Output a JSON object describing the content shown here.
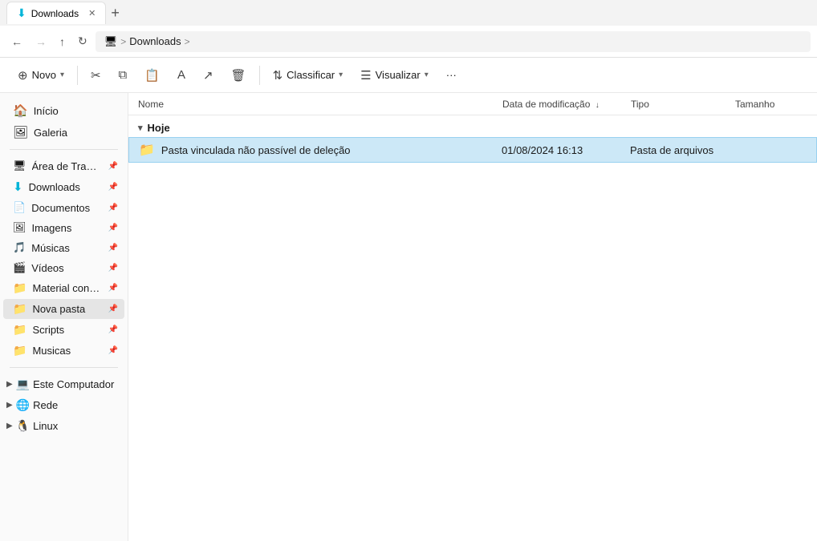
{
  "titlebar": {
    "tab_label": "Downloads",
    "new_tab_icon": "+",
    "tab_close": "✕"
  },
  "addressbar": {
    "nav_back": "←",
    "nav_forward": "→",
    "nav_up": "↑",
    "nav_refresh": "↻",
    "monitor_icon": "🖥",
    "breadcrumb_sep": ">",
    "path_item": "Downloads",
    "path_arrow": ">"
  },
  "toolbar": {
    "novo_label": "Novo",
    "cut_icon": "✂",
    "copy_icon": "⧉",
    "paste_icon": "📋",
    "rename_icon": "A",
    "share_icon": "↗",
    "delete_icon": "🗑",
    "classificar_label": "Classificar",
    "visualizar_label": "Visualizar",
    "more_icon": "···"
  },
  "sidebar": {
    "items": [
      {
        "label": "Início",
        "icon": "🏠",
        "pinned": false
      },
      {
        "label": "Galeria",
        "icon": "🖼",
        "pinned": false
      }
    ],
    "pinned_items": [
      {
        "label": "Área de Trabalho",
        "icon": "🖥",
        "pinned": true
      },
      {
        "label": "Downloads",
        "icon": "⬇",
        "pinned": true
      },
      {
        "label": "Documentos",
        "icon": "📄",
        "pinned": true
      },
      {
        "label": "Imagens",
        "icon": "🖼",
        "pinned": true
      },
      {
        "label": "Músicas",
        "icon": "🎵",
        "pinned": true
      },
      {
        "label": "Vídeos",
        "icon": "🎬",
        "pinned": true
      },
      {
        "label": "Material conceit",
        "icon": "📁",
        "pinned": true
      },
      {
        "label": "Nova pasta",
        "icon": "📁",
        "pinned": true,
        "active": true
      },
      {
        "label": "Scripts",
        "icon": "📁",
        "pinned": true
      },
      {
        "label": "Musicas",
        "icon": "📁",
        "pinned": true
      }
    ],
    "expandable_items": [
      {
        "label": "Este Computador",
        "icon": "💻",
        "color": "#0078d4"
      },
      {
        "label": "Rede",
        "icon": "🌐",
        "color": "#0078d4"
      },
      {
        "label": "Linux",
        "icon": "🐧",
        "color": "#000"
      }
    ]
  },
  "content": {
    "columns": {
      "name": "Nome",
      "date": "Data de modificação",
      "type": "Tipo",
      "size": "Tamanho",
      "sort_icon": "↓"
    },
    "groups": [
      {
        "label": "Hoje",
        "expanded": true,
        "files": [
          {
            "name": "Pasta vinculada não passível de deleção",
            "icon": "📁",
            "date": "01/08/2024 16:13",
            "type": "Pasta de arquivos",
            "size": "",
            "selected": true
          }
        ]
      }
    ]
  }
}
